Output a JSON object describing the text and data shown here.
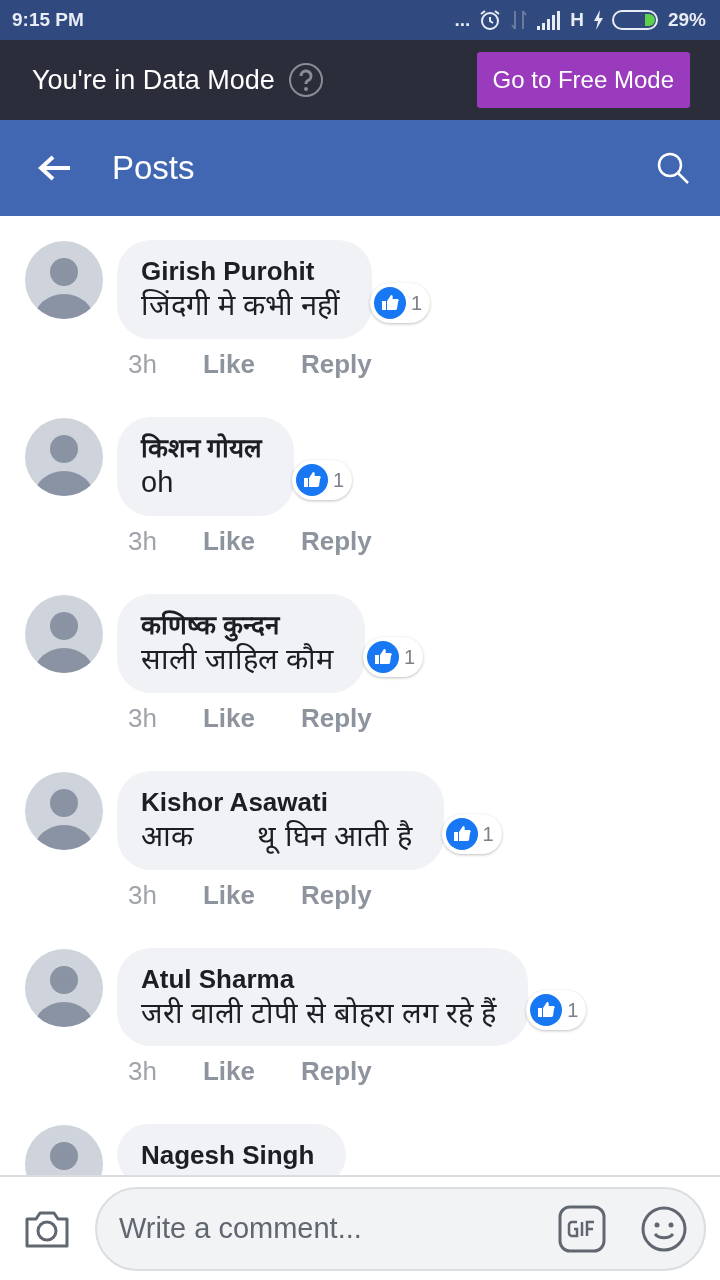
{
  "status_bar": {
    "time": "9:15 PM",
    "dots": "...",
    "network": "H",
    "battery": "29%"
  },
  "data_mode_bar": {
    "message": "You're in Data Mode",
    "button": "Go to Free Mode"
  },
  "header": {
    "title": "Posts"
  },
  "comments": [
    {
      "author": "Girish Purohit",
      "text": "जिंदगी मे कभी नहीं",
      "reactions": "1",
      "time": "3h",
      "actions": [
        "Like",
        "Reply"
      ]
    },
    {
      "author": "किशन गोयल",
      "text": "oh",
      "reactions": "1",
      "time": "3h",
      "actions": [
        "Like",
        "Reply"
      ]
    },
    {
      "author": "कणिष्क कुन्दन",
      "text": "साली जाहिल कौम",
      "reactions": "1",
      "time": "3h",
      "actions": [
        "Like",
        "Reply"
      ]
    },
    {
      "author": "Kishor Asawati",
      "text": "आक        थू घिन आती है",
      "reactions": "1",
      "time": "3h",
      "actions": [
        "Like",
        "Reply"
      ]
    },
    {
      "author": "Atul Sharma",
      "text": "जरी वाली टोपी से बोहरा लग रहे हैं",
      "reactions": "1",
      "time": "3h",
      "actions": [
        "Like",
        "Reply"
      ]
    },
    {
      "author": "Nagesh Singh"
    }
  ],
  "composer": {
    "placeholder": "Write a comment..."
  }
}
